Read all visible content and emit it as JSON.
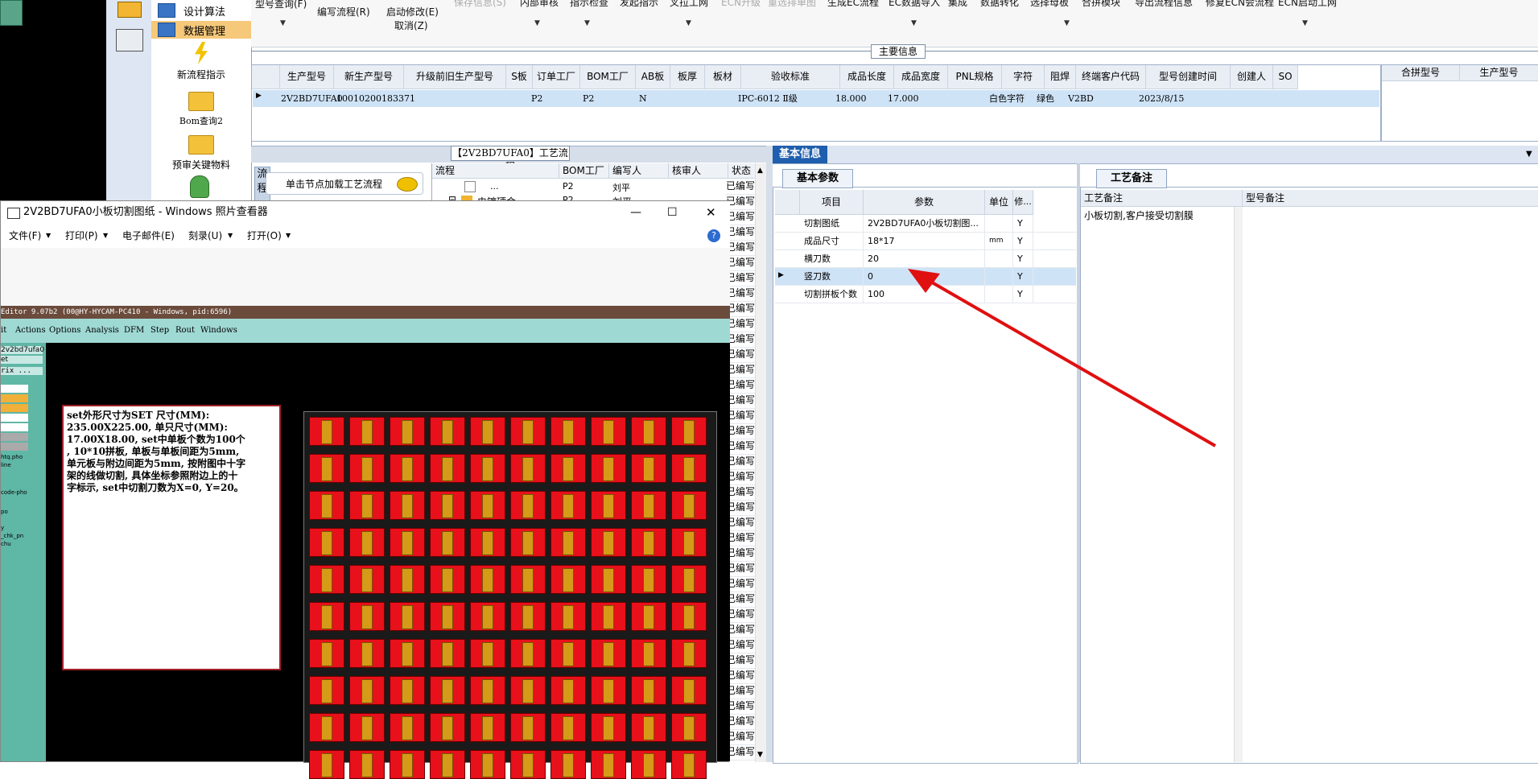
{
  "nav": {
    "items": [
      {
        "label": "设计算法"
      },
      {
        "label": "数据管理"
      }
    ],
    "buttons": [
      {
        "label": "新流程指示"
      },
      {
        "label": "Bom查询2"
      },
      {
        "label": "预审关键物料"
      }
    ]
  },
  "ribbon": {
    "items": [
      {
        "label": "型号查询(F)"
      },
      {
        "label": "编写流程(R)"
      },
      {
        "label": "启动修改(E)"
      },
      {
        "label": "取消(Z)"
      },
      {
        "label": "保存信息(S)"
      },
      {
        "label": "内部审核"
      },
      {
        "label": "指示检查"
      },
      {
        "label": "发起指示"
      },
      {
        "label": "叉拉工网"
      },
      {
        "label": "ECN升级"
      },
      {
        "label": "重选排单图"
      },
      {
        "label": "生成EC流程"
      },
      {
        "label": "EC数据导入"
      },
      {
        "label": "集成"
      },
      {
        "label": "数据转化"
      },
      {
        "label": "选择母板"
      },
      {
        "label": "合拼模块"
      },
      {
        "label": "导出流程信息"
      },
      {
        "label": "修复ECN会流程"
      },
      {
        "label": "ECN启动工网"
      }
    ]
  },
  "main_info": {
    "title": "主要信息",
    "columns": [
      "生产型号",
      "新生产型号",
      "升级前旧生产型号",
      "S板",
      "订单工厂",
      "BOM工厂",
      "AB板",
      "板厚",
      "板材",
      "验收标准",
      "成品长度",
      "成品宽度",
      "PNL规格",
      "字符",
      "阻焊",
      "终端客户代码",
      "型号创建时间",
      "创建人",
      "SO"
    ],
    "row": {
      "production_model": "2V2BD7UFA0",
      "new_model": "10010200183371",
      "order_factory": "P2",
      "bom_factory": "P2",
      "ab_board": "N",
      "standard": "IPC-6012 Ⅱ级",
      "length": "18.000",
      "width": "17.000",
      "char": "白色字符",
      "solder": "绿色",
      "customer": "V2BD",
      "created": "2023/8/15"
    },
    "right_columns": [
      "合拼型号",
      "生产型号"
    ]
  },
  "process": {
    "title": "【2V2BD7UFA0】工艺流程",
    "load_hint": "单击节点加载工艺流程",
    "side_label": "流程",
    "columns": [
      "流程",
      "BOM工厂",
      "编写人",
      "核审人",
      "状态"
    ],
    "rows": [
      {
        "name": "...",
        "factory": "P2",
        "author": "刘平"
      },
      {
        "name": "电镀硬金",
        "factory": "P2",
        "author": "刘平"
      }
    ],
    "status_value": "已编写"
  },
  "basic_info": {
    "tab": "基本信息",
    "params_tab": "基本参数",
    "columns": [
      "项目",
      "参数",
      "单位",
      "修..."
    ],
    "rows": [
      {
        "item": "切割图纸",
        "value": "2V2BD7UFA0小板切割图...",
        "unit": "",
        "flag": "Y"
      },
      {
        "item": "成品尺寸",
        "value": "18*17",
        "unit": "mm",
        "flag": "Y"
      },
      {
        "item": "横刀数",
        "value": "20",
        "unit": "",
        "flag": "Y"
      },
      {
        "item": "竖刀数",
        "value": "0",
        "unit": "",
        "flag": "Y"
      },
      {
        "item": "切割拼板个数",
        "value": "100",
        "unit": "",
        "flag": "Y"
      }
    ],
    "notes_tab": "工艺备注",
    "notes_columns": [
      "工艺备注",
      "型号备注"
    ],
    "process_note": "小板切割,客户接受切割膜"
  },
  "viewer": {
    "title": "2V2BD7UFA0小板切割图纸 - Windows 照片查看器",
    "menu": [
      "文件(F)",
      "打印(P)",
      "电子邮件(E)",
      "刻录(U)",
      "打开(O)"
    ],
    "cam_title": "Editor 9.07b2 (00@HY-HYCAM-PC410 - Windows, pid:6596)",
    "cam_menu": [
      "it",
      "Actions",
      "Options",
      "Analysis",
      "DFM",
      "Step",
      "Rout",
      "Windows"
    ],
    "cam_side": [
      "2v2bd7ufa0",
      "et",
      "rix ...",
      "htq.pho",
      "line",
      "code-pho",
      "po",
      "y",
      "_chk_pn",
      "chu"
    ],
    "note": "set外形尺寸为SET 尺寸(MM):\n235.00X225.00, 单只尺寸(MM):\n17.00X18.00, set中单板个数为100个\n, 10*10拼板, 单板与单板间距为5mm,\n单元板与附边间距为5mm, 按附图中十字\n架的线做切割, 具体坐标参照附边上的十\n字标示, set中切割刀数为X=0, Y=20。"
  },
  "colors": {
    "accent": "#1f5fae",
    "selection": "#cfe3f7",
    "arrow": "#e01010",
    "board_red": "#e8101a",
    "gold": "#d49a18"
  }
}
